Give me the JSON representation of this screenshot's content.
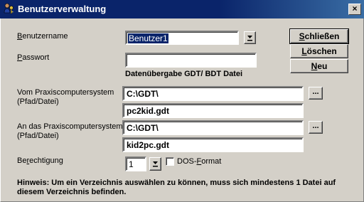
{
  "window": {
    "title": "Benutzerverwaltung",
    "close_label": "×",
    "icon": "users-key-icon"
  },
  "form": {
    "username_label_u": "B",
    "username_label_rest": "enutzername",
    "username_value": "Benutzer1",
    "password_label_u": "P",
    "password_label_rest": "asswort",
    "password_value": "",
    "gdt_heading": "Datenübergabe GDT/ BDT Datei",
    "from_label_line1": "Vom Praxiscomputersystem",
    "from_label_line2": "(Pfad/Datei)",
    "from_path": "C:\\GDT\\",
    "from_file": "pc2kid.gdt",
    "to_label_line1": "An das Praxiscomputersystem",
    "to_label_line2": "(Pfad/Datei)",
    "to_path": "C:\\GDT\\",
    "to_file": "kid2pc.gdt",
    "browse_label": "...",
    "permission_label_pre": "Be",
    "permission_label_u": "r",
    "permission_label_rest": "echtigung",
    "permission_value": "1",
    "dos_format_pre": "DOS-",
    "dos_format_u": "F",
    "dos_format_rest": "ormat",
    "dos_format_checked": false
  },
  "buttons": {
    "close_u": "S",
    "close_rest": "chließen",
    "close_pre": "",
    "delete_pre": "",
    "delete_u": "L",
    "delete_rest": "öschen",
    "new_pre": "",
    "new_u": "N",
    "new_rest": "eu"
  },
  "hint_text": "Hinweis: Um ein Verzeichnis auswählen zu können, muss sich mindestens 1 Datei auf diesem Verzeichnis befinden.",
  "colors": {
    "titlebar": "#0a246a",
    "face": "#d4d0c8",
    "selection": "#0a246a"
  }
}
